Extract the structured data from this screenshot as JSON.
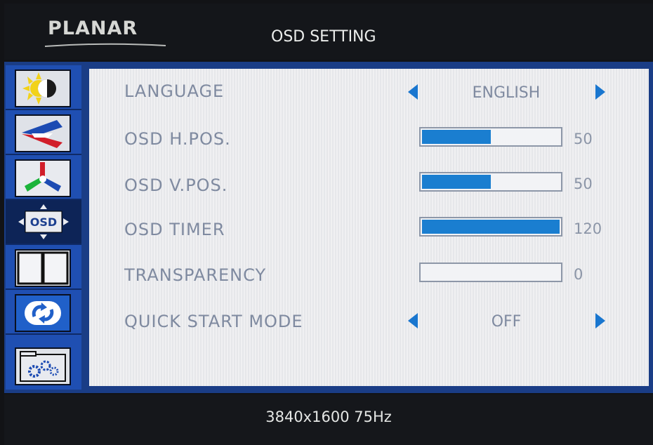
{
  "header": {
    "brand": "PLANAR",
    "title": "OSD SETTING"
  },
  "sidebar": {
    "items": [
      {
        "icon": "brightness-contrast-icon"
      },
      {
        "icon": "picture-image-icon"
      },
      {
        "icon": "color-adjust-icon"
      },
      {
        "icon": "osd-icon",
        "label": "OSD",
        "active": true
      },
      {
        "icon": "pip-split-icon"
      },
      {
        "icon": "reset-icon"
      },
      {
        "icon": "system-settings-icon"
      }
    ]
  },
  "settings": [
    {
      "label": "LANGUAGE",
      "type": "select",
      "value": "ENGLISH"
    },
    {
      "label": "OSD H.POS.",
      "type": "slider",
      "value": "50",
      "fill_fraction": 0.5
    },
    {
      "label": "OSD V.POS.",
      "type": "slider",
      "value": "50",
      "fill_fraction": 0.5
    },
    {
      "label": "OSD TIMER",
      "type": "slider",
      "value": "120",
      "fill_fraction": 1.0
    },
    {
      "label": "TRANSPARENCY",
      "type": "slider",
      "value": "0",
      "fill_fraction": 0.0
    },
    {
      "label": "QUICK START MODE",
      "type": "select",
      "value": "OFF"
    }
  ],
  "status": {
    "resolution": "3840x1600 75Hz"
  },
  "colors": {
    "accent": "#1a7ed0",
    "sidebar": "#1f4fb2",
    "sidebar_active": "#0d2457"
  }
}
